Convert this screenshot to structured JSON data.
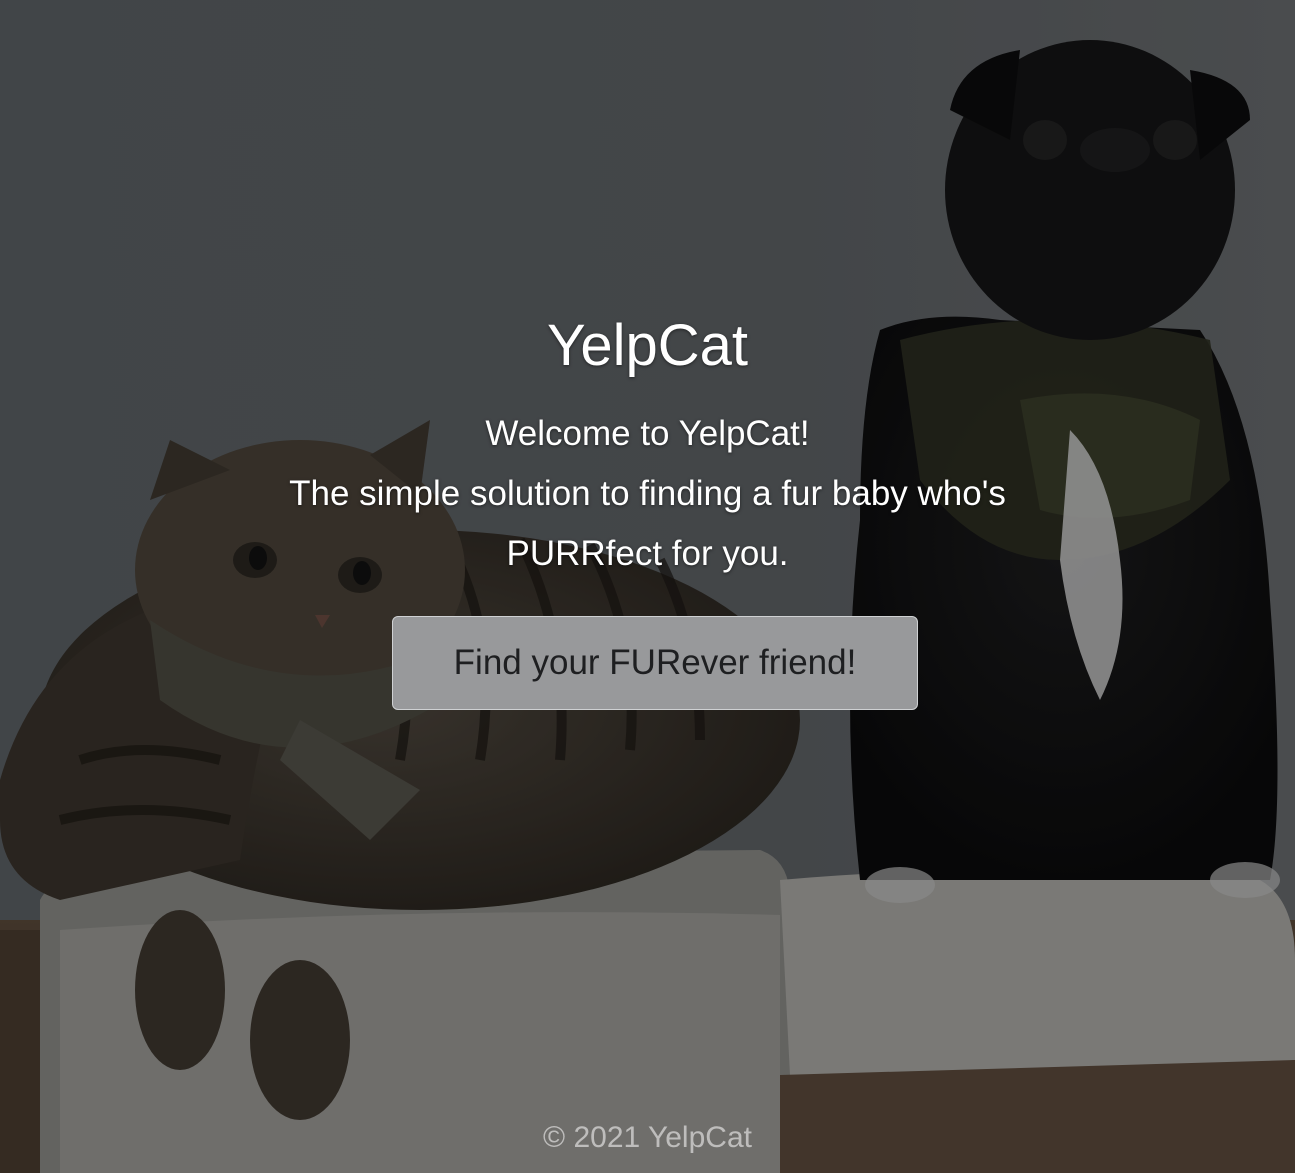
{
  "hero": {
    "title": "YelpCat",
    "lead_line1": "Welcome to YelpCat!",
    "lead_line2": "The simple solution to finding a fur baby who's",
    "lead_line3": "PURRfect for you.",
    "cta_label": "Find your FURever friend!",
    "background_image": "photo-cat-and-pug"
  },
  "footer": {
    "copyright": "© 2021 YelpCat"
  },
  "colors": {
    "overlay": "#5c6064",
    "text": "#ffffff",
    "button_bg": "#98999b",
    "button_text": "#1e1f21"
  }
}
